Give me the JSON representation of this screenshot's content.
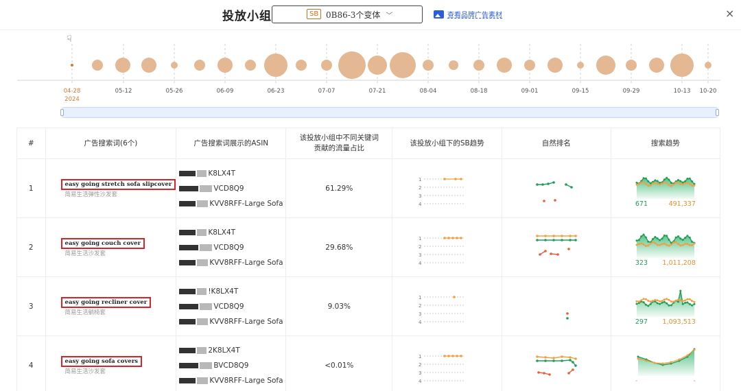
{
  "header": {
    "title": "投放小组",
    "select_badge": "SB",
    "select_value": "0B86-3个变体",
    "material_link": "查看品牌广告素材",
    "close_symbol": "×"
  },
  "timeline": {
    "ticks": [
      "04-28",
      "05-12",
      "05-26",
      "06-09",
      "06-23",
      "07-07",
      "07-21",
      "08-04",
      "08-18",
      "09-01",
      "09-15",
      "09-29",
      "10-13",
      "10-20"
    ],
    "active_tick_year": "2024",
    "bubble_color": "#e3b893",
    "active_color": "#d97a2a"
  },
  "table": {
    "headers": {
      "index": "#",
      "keyword": "广告搜索词(6个)",
      "asin": "广告搜索词展示的ASIN",
      "share_line1": "该投放小组中不同关键词",
      "share_line2": "贡献的流量占比",
      "sb_trend": "该投放小组下的SB趋势",
      "organic_rank": "自然排名",
      "search_trend": "搜索趋势"
    },
    "rows": [
      {
        "index": "1",
        "keyword": "easy going stretch sofa slipcover",
        "keyword_cn": "简易生活弹性沙发套",
        "asins": [
          "K8LX4T",
          "VCD8Q9",
          "KVV8RFF-Large Sofa"
        ],
        "share": "61.29%",
        "search_left": "671",
        "search_right": "491,337"
      },
      {
        "index": "2",
        "keyword": "easy going couch cover",
        "keyword_cn": "简易生活沙发套",
        "asins": [
          "K8LX4T",
          "VCD8Q9",
          "KVV8RFF-Large Sofa"
        ],
        "share": "29.68%",
        "search_left": "323",
        "search_right": "1,011,208"
      },
      {
        "index": "3",
        "keyword": "easy going recliner cover",
        "keyword_cn": "简易生活躺椅套",
        "asins": [
          "!K8LX4T",
          "VCD8Q9",
          "KVV8RFF-Large Sofa"
        ],
        "share": "9.03%",
        "search_left": "297",
        "search_right": "1,093,513"
      },
      {
        "index": "4",
        "keyword": "easy going sofa covers",
        "keyword_cn": "简易生活沙发套",
        "asins": [
          "2K8LX4T",
          "BVCD8Q9",
          "KVV8RFF-Large Sofa"
        ],
        "share": "<0.01%",
        "search_left": "-",
        "search_right": "-"
      }
    ],
    "rank_axis": [
      "1",
      "2",
      "3",
      "4"
    ]
  },
  "colors": {
    "green": "#1f9e57",
    "orange": "#f0a040",
    "red": "#e8603a",
    "keyword_border": "#d8232a"
  }
}
